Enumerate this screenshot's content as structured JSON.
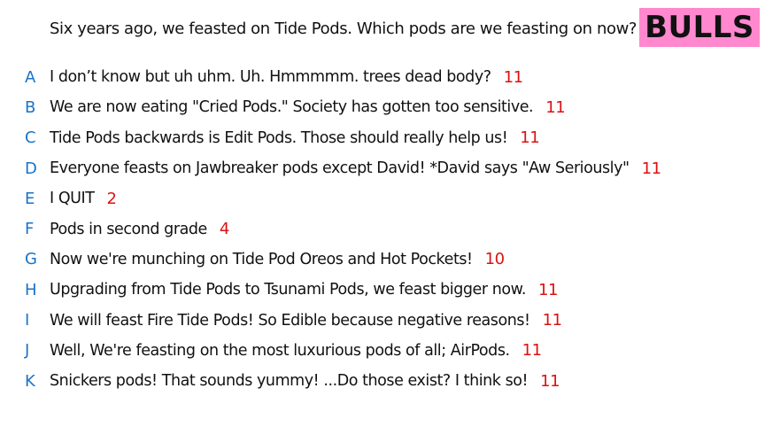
{
  "question": "Six years ago, we feasted on Tide Pods. Which pods are we feasting on now?",
  "team": {
    "label": "BULLS",
    "bg_color": "#ff88cf"
  },
  "colors": {
    "letter": "#1a73c8",
    "score": "#dd1111"
  },
  "answers": [
    {
      "letter": "A",
      "text": "I don’t know but uh uhm. Uh. Hmmmmm. trees dead body?",
      "score": "11"
    },
    {
      "letter": "B",
      "text": "We are now eating \"Cried Pods.\" Society has gotten too sensitive.",
      "score": "11"
    },
    {
      "letter": "C",
      "text": "Tide Pods backwards is Edit Pods. Those should really help us!",
      "score": "11"
    },
    {
      "letter": "D",
      "text": "Everyone feasts on Jawbreaker pods except David! *David says \"Aw Seriously\"",
      "score": "11"
    },
    {
      "letter": "E",
      "text": "I QUIT",
      "score": "2"
    },
    {
      "letter": "F",
      "text": "Pods in second grade",
      "score": "4"
    },
    {
      "letter": "G",
      "text": "Now we're munching on Tide Pod Oreos and Hot Pockets!",
      "score": "10"
    },
    {
      "letter": "H",
      "text": "Upgrading from Tide Pods to Tsunami Pods, we feast bigger now.",
      "score": "11"
    },
    {
      "letter": "I",
      "text": "We will feast Fire Tide Pods! So Edible because negative reasons!",
      "score": "11"
    },
    {
      "letter": "J",
      "text": "Well, We're feasting on the most luxurious pods of all; AirPods.",
      "score": "11"
    },
    {
      "letter": "K",
      "text": "Snickers pods! That sounds yummy! ...Do those exist? I think so!",
      "score": "11"
    }
  ]
}
